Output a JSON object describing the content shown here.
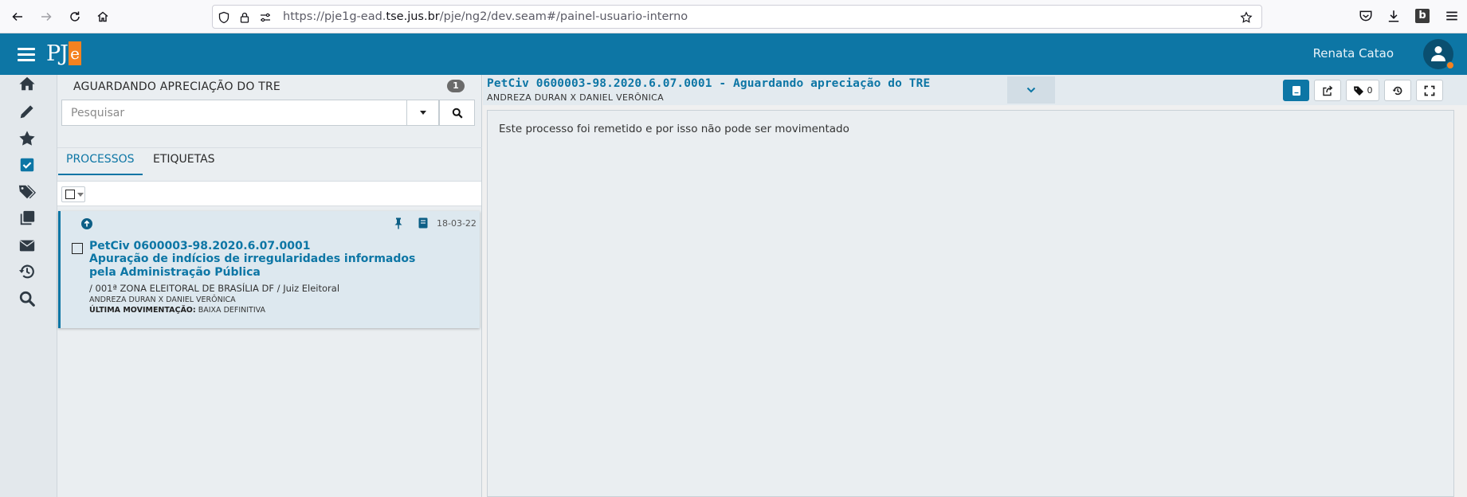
{
  "browser": {
    "url_prefix": "https://pje1g-ead.",
    "url_domain": "tse.jus.br",
    "url_suffix": "/pje/ng2/dev.seam#/painel-usuario-interno"
  },
  "header": {
    "logo_text": "PJ",
    "logo_accent": "e",
    "user_name": "Renata Catao",
    "colors": {
      "brand": "#0d76a5",
      "accent": "#f58220"
    }
  },
  "rail": {
    "icons": [
      "home-icon",
      "pencil-icon",
      "star-icon",
      "checkbox-icon",
      "tags-icon",
      "copies-icon",
      "envelope-icon",
      "history-icon",
      "search-icon"
    ]
  },
  "list": {
    "title": "AGUARDANDO APRECIAÇÃO DO TRE",
    "count": "1",
    "search_placeholder": "Pesquisar",
    "tabs": [
      {
        "label": "PROCESSOS",
        "active": true
      },
      {
        "label": "ETIQUETAS",
        "active": false
      }
    ],
    "items": [
      {
        "date": "18-03-22",
        "number": "PetCiv 0600003-98.2020.6.07.0001",
        "subject": "Apuração de indícios de irregularidades informados pela Administração Pública",
        "orgao": "/ 001ª ZONA ELEITORAL DE BRASÍLIA DF / Juiz Eleitoral",
        "parties": "ANDREZA DURAN X DANIEL VERÔNICA",
        "last_mov_label": "ÚLTIMA MOVIMENTAÇÃO:",
        "last_mov_value": "BAIXA DEFINITIVA"
      }
    ]
  },
  "detail": {
    "title": "PetCiv 0600003-98.2020.6.07.0001 - Aguardando apreciação do TRE",
    "parties": "ANDREZA DURAN X DANIEL VERÔNICA",
    "tag_count": "0",
    "message": "Este processo foi remetido e por isso não pode ser movimentado"
  }
}
